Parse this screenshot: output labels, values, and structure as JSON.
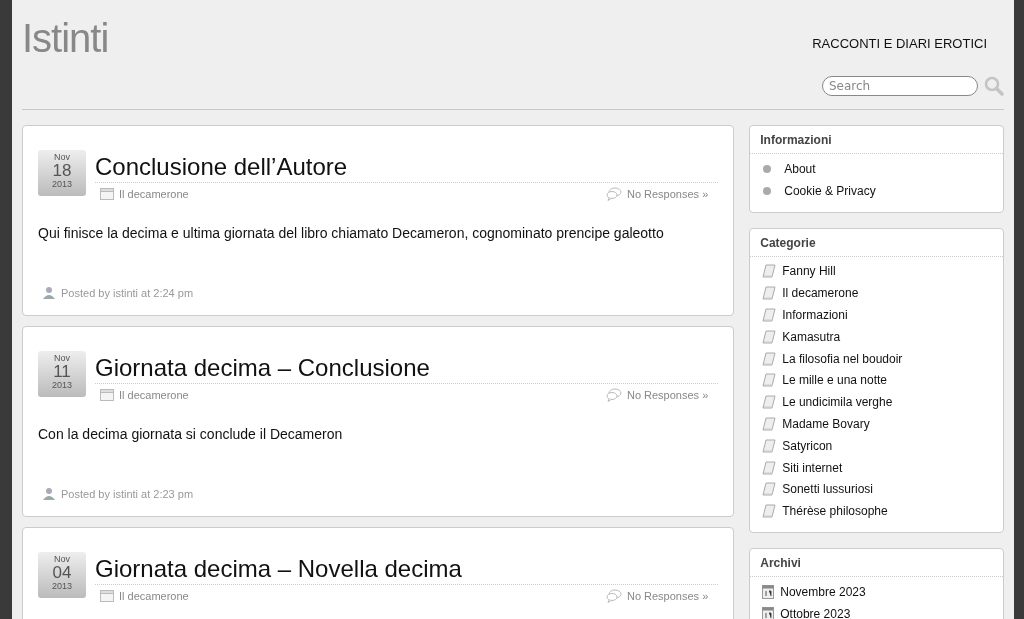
{
  "site": {
    "title": "Istinti",
    "tagline": "RACCONTI E DIARI EROTICI"
  },
  "search": {
    "placeholder": "Search"
  },
  "posts": [
    {
      "month": "Nov",
      "day": "18",
      "year": "2013",
      "title": "Conclusione dell’Autore",
      "category": "Il decamerone",
      "comments": "No Responses »",
      "body": "Qui finisce la decima e ultima giornata del libro chiamato Decameron, cognominato prencipe galeotto",
      "footer": "Posted by istinti at 2:24 pm"
    },
    {
      "month": "Nov",
      "day": "11",
      "year": "2013",
      "title": "Giornata decima – Conclusione",
      "category": "Il decamerone",
      "comments": "No Responses »",
      "body": "Con la decima giornata si conclude il Decameron",
      "footer": "Posted by istinti at 2:23 pm"
    },
    {
      "month": "Nov",
      "day": "04",
      "year": "2013",
      "title": "Giornata decima – Novella decima",
      "category": "Il decamerone",
      "comments": "No Responses »"
    }
  ],
  "widgets": [
    {
      "title": "Informazioni",
      "kind": "bullet",
      "items": [
        "About",
        "Cookie & Privacy"
      ]
    },
    {
      "title": "Categorie",
      "kind": "book",
      "items": [
        "Fanny Hill",
        "Il decamerone",
        "Informazioni",
        "Kamasutra",
        "La filosofia nel boudoir",
        "Le mille e una notte",
        "Le undicimila verghe",
        "Madame Bovary",
        "Satyricon",
        "Siti internet",
        "Sonetti lussuriosi",
        "Thérèse philosophe"
      ]
    },
    {
      "title": "Archivi",
      "kind": "calendar",
      "items": [
        "Novembre 2023",
        "Ottobre 2023"
      ]
    }
  ]
}
